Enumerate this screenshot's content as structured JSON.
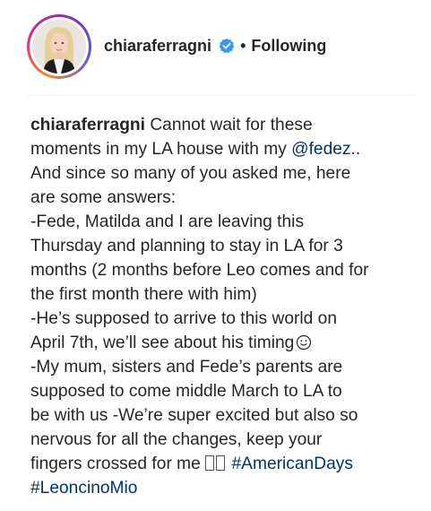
{
  "header": {
    "username": "chiaraferragni",
    "separator": "•",
    "follow_status": "Following",
    "avatar_icon": "profile-photo",
    "verified_icon": "verified-badge-icon"
  },
  "caption": {
    "username": "chiaraferragni",
    "line1": " Cannot wait for these",
    "line2a": "moments in my LA house with my ",
    "mention": "@fedez",
    "line2b": "..",
    "line3": "And since so many of you asked me, here",
    "line4": "are some answers:",
    "line5": "-Fede, Matilda and I are leaving this",
    "line6": "Thursday and planning to stay in LA for 3",
    "line7": "months (2 months before Leo comes and for",
    "line8": "the first month there with him)",
    "line9": "-He’s supposed to arrive to this world on",
    "line10": "April 7th, we’ll see about his timing",
    "line11": "-My mum, sisters and Fede’s parents are",
    "line12": "supposed to come middle March to LA to",
    "line13": "be with us -We’re super excited but also so",
    "line14": "nervous for all the changes, keep your",
    "line15": "fingers crossed for me ",
    "hashtag1": "#AmericanDays",
    "hashtag2": "#LeoncinoMio"
  },
  "colors": {
    "text": "#262626",
    "link": "#003569",
    "verified": "#3897f0",
    "divider": "#efefef"
  }
}
